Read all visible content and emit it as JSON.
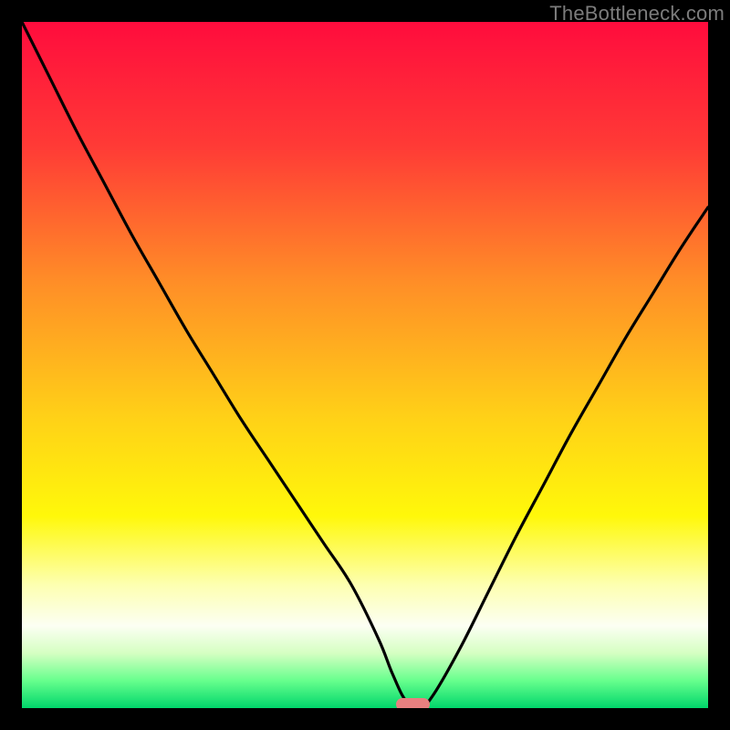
{
  "watermark": "TheBottleneck.com",
  "chart_data": {
    "type": "line",
    "title": "",
    "xlabel": "",
    "ylabel": "",
    "xlim": [
      0,
      100
    ],
    "ylim": [
      0,
      100
    ],
    "x": [
      0,
      4,
      8,
      12,
      16,
      20,
      24,
      28,
      32,
      36,
      40,
      44,
      48,
      52,
      54,
      56,
      58,
      60,
      64,
      68,
      72,
      76,
      80,
      84,
      88,
      92,
      96,
      100
    ],
    "y": [
      100,
      92,
      84,
      76.5,
      69,
      62,
      55,
      48.5,
      42,
      36,
      30,
      24,
      18,
      10,
      5,
      1,
      0,
      2,
      9,
      17,
      25,
      32.5,
      40,
      47,
      54,
      60.5,
      67,
      73
    ],
    "annotations": {
      "min_marker": {
        "x": 57,
        "y": 0,
        "width": 5,
        "color": "#e88080"
      }
    },
    "gradient_stops": [
      {
        "pct": 0,
        "color": "#ff0c3d"
      },
      {
        "pct": 18,
        "color": "#ff3a36"
      },
      {
        "pct": 38,
        "color": "#ff8e27"
      },
      {
        "pct": 58,
        "color": "#ffd217"
      },
      {
        "pct": 72,
        "color": "#fff80a"
      },
      {
        "pct": 82,
        "color": "#fdffb0"
      },
      {
        "pct": 88,
        "color": "#fcfff3"
      },
      {
        "pct": 92,
        "color": "#d5ffc2"
      },
      {
        "pct": 96,
        "color": "#67ff8d"
      },
      {
        "pct": 100,
        "color": "#00d66b"
      }
    ]
  }
}
